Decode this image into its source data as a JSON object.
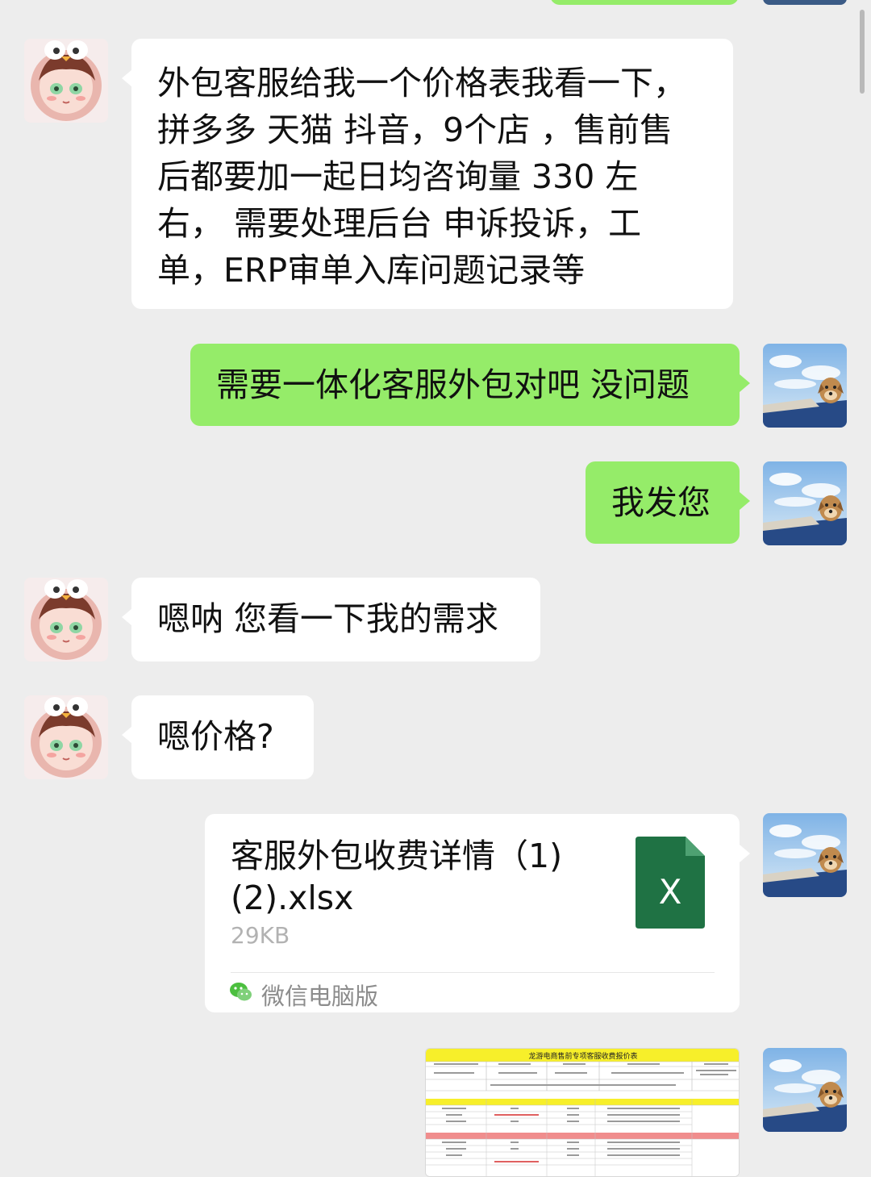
{
  "messages": [
    {
      "side": "left",
      "text_lines": [
        "外包客服给我一个价格表我看一下，",
        "拼多多 天猫 抖音，9个店 ，售前售",
        "后都要加一起日均咨询量 330 左",
        "右， 需要处理后台 申诉投诉，工",
        "单，ERP审单入库问题记录等"
      ]
    },
    {
      "side": "right",
      "text": "需要一体化客服外包对吧 没问题"
    },
    {
      "side": "right",
      "text": "我发您"
    },
    {
      "side": "left",
      "text": "嗯呐 您看一下我的需求"
    },
    {
      "side": "left",
      "text": "嗯价格?"
    },
    {
      "side": "right",
      "type": "file",
      "file_name_lines": [
        "客服外包收费详情（1)",
        "(2).xlsx"
      ],
      "file_size": "29KB",
      "source": "微信电脑版",
      "icon": "excel-file-icon",
      "icon_letter": "X",
      "icon_color": "#1f7244"
    },
    {
      "side": "right",
      "type": "image",
      "image_title": "龙游电商售前专项客服收费报价表",
      "description_icon": "spreadsheet-image"
    }
  ],
  "colors": {
    "background": "#ededed",
    "bubble_self": "#95ec69",
    "bubble_other": "#ffffff",
    "text": "#111111",
    "meta_text": "#b2b2b2"
  }
}
